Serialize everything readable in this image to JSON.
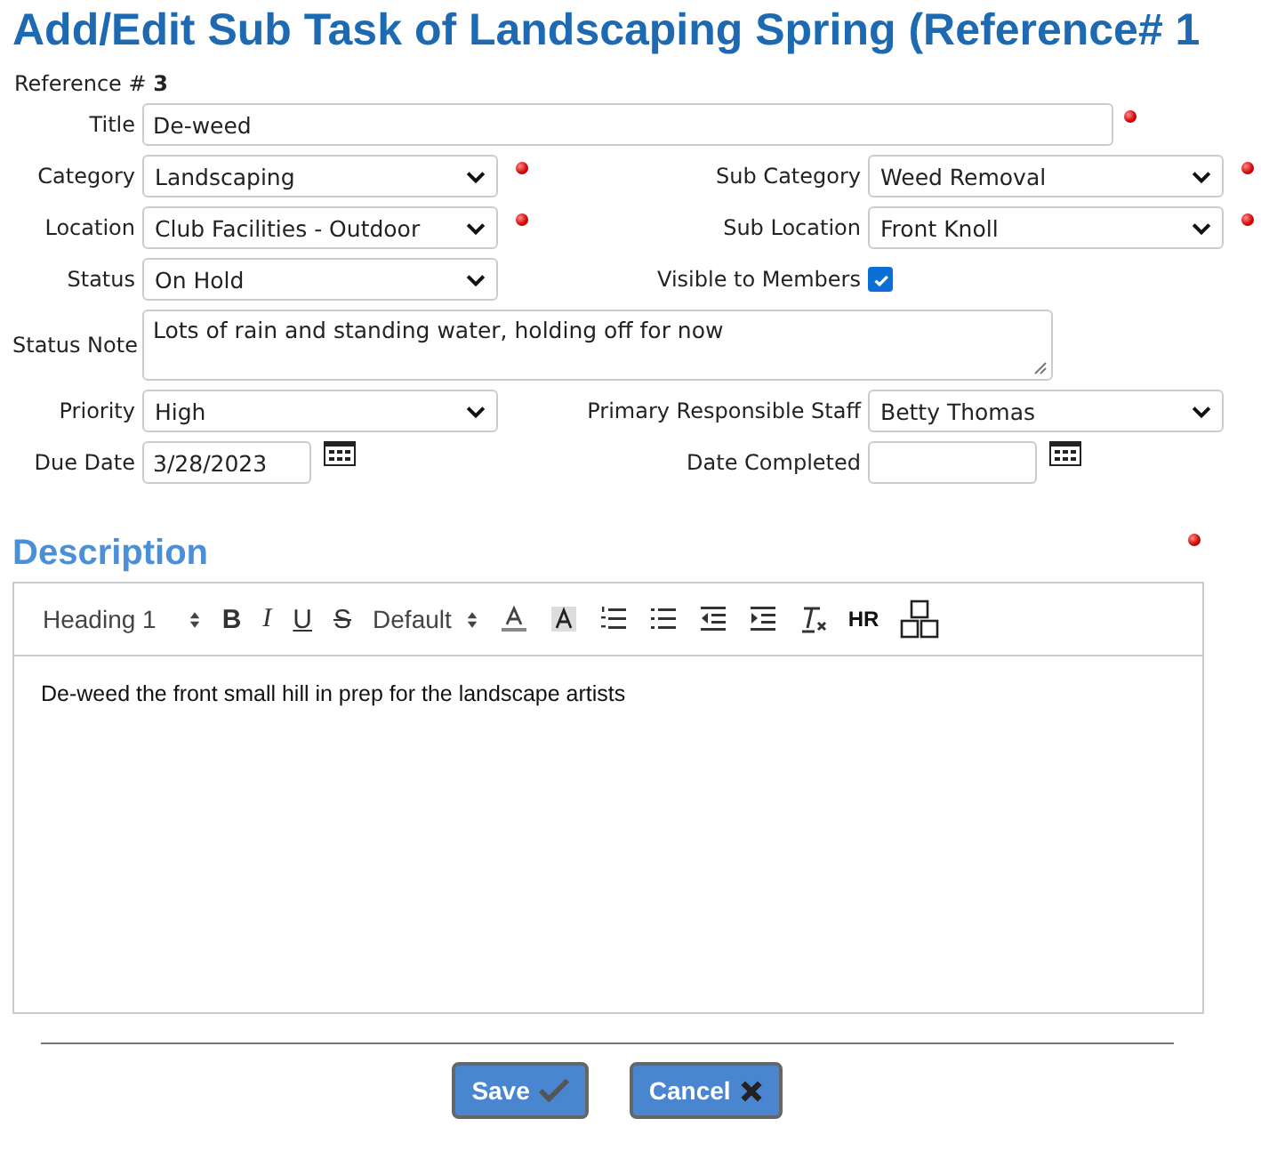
{
  "page_title": "Add/Edit Sub Task of Landscaping Spring (Reference# 1",
  "reference": {
    "label": "Reference #",
    "value": "3"
  },
  "rows": [
    [
      {
        "label": "Title",
        "kind": "text",
        "value": "De-weed",
        "required": true
      }
    ],
    [
      {
        "label": "Category",
        "kind": "select",
        "value": "Landscaping",
        "required": true
      },
      {
        "label": "Sub Category",
        "kind": "select",
        "value": "Weed Removal",
        "required": true
      }
    ],
    [
      {
        "label": "Location",
        "kind": "select",
        "value": "Club Facilities - Outdoor",
        "required": true
      },
      {
        "label": "Sub Location",
        "kind": "select",
        "value": "Front Knoll",
        "required": true
      }
    ],
    [
      {
        "label": "Status",
        "kind": "select",
        "value": "On Hold"
      },
      {
        "label": "Visible to Members",
        "kind": "checkbox",
        "checked": true
      }
    ],
    [
      {
        "label": "Status Note",
        "kind": "textarea",
        "value": "Lots of rain and standing water, holding off for now"
      }
    ],
    [
      {
        "label": "Priority",
        "kind": "select",
        "value": "High"
      },
      {
        "label": "Primary Responsible Staff",
        "kind": "select",
        "value": "Betty Thomas"
      }
    ],
    [
      {
        "label": "Due Date",
        "kind": "date",
        "value": "3/28/2023"
      },
      {
        "label": "Date Completed",
        "kind": "date"
      }
    ]
  ],
  "description": {
    "heading": "Description",
    "required": true,
    "toolbar": [
      {
        "kind": "select",
        "label": "Heading 1"
      },
      {
        "kind": "bold",
        "label": "B"
      },
      {
        "kind": "italic",
        "label": "I"
      },
      {
        "kind": "underline",
        "label": "U"
      },
      {
        "kind": "strike",
        "label": "S"
      },
      {
        "kind": "select",
        "label": "Default"
      },
      {
        "kind": "fontcolor"
      },
      {
        "kind": "highlight"
      },
      {
        "kind": "numbered"
      },
      {
        "kind": "bulleted"
      },
      {
        "kind": "outdent"
      },
      {
        "kind": "indent"
      },
      {
        "kind": "clear"
      },
      {
        "kind": "hr",
        "label": "HR"
      },
      {
        "kind": "blocks"
      }
    ],
    "content": "De-weed the front small hill in prep for the landscape artists"
  },
  "buttons": [
    {
      "label": "Save",
      "kind": "save"
    },
    {
      "label": "Cancel",
      "kind": "cancel"
    }
  ]
}
